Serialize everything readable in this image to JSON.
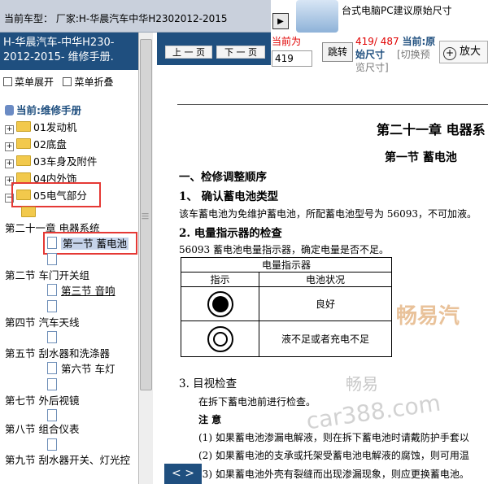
{
  "header": {
    "car_model": "当前车型： 厂家:H-华晨汽车中华H2302012-2015",
    "banner_text": "台式电脑PC建议原始尺寸"
  },
  "sidebar": {
    "doc_title": "H-华晨汽车-中华H230-2012-2015- 维修手册.",
    "expand_all": "菜单展开",
    "collapse_all": "菜单折叠",
    "root_label": "当前:维修手册",
    "folders": [
      "01发动机",
      "02底盘",
      "03车身及附件",
      "04内外饰",
      "05电气部分"
    ],
    "items": [
      {
        "label": "第二十一章 电器系统",
        "type": "chapter"
      },
      {
        "label": "第一节 蓄电池",
        "type": "page",
        "selected": true
      },
      {
        "label": "",
        "type": "page"
      },
      {
        "label": "第二节 车门开关组",
        "type": "chapter"
      },
      {
        "label": "第三节 音响",
        "type": "page"
      },
      {
        "label": "",
        "type": "page"
      },
      {
        "label": "第四节 汽车天线",
        "type": "chapter"
      },
      {
        "label": "",
        "type": "page"
      },
      {
        "label": "第五节 刮水器和洗涤器",
        "type": "chapter"
      },
      {
        "label": "第六节 车灯",
        "type": "page"
      },
      {
        "label": "",
        "type": "page"
      },
      {
        "label": "第七节 外后视镜",
        "type": "chapter"
      },
      {
        "label": "",
        "type": "page"
      },
      {
        "label": "第八节 组合仪表",
        "type": "chapter"
      },
      {
        "label": "",
        "type": "page"
      },
      {
        "label": "第九节 刮水器开关、灯光控",
        "type": "chapter"
      }
    ]
  },
  "toolbar": {
    "prev_page": "上 一 页",
    "next_page": "下 一 页",
    "page_label": "当前为",
    "page_value": "419",
    "jump": "跳转",
    "page_count": "419/ 487",
    "current_label": "当前:原",
    "mode_label": "始尺寸",
    "switch_label": "[切换预",
    "switch_label2": "览尺寸]",
    "zoom": "放大"
  },
  "document": {
    "chapter_title": "第二十一章  电器系",
    "section_title": "第一节  蓄电池",
    "h1": "一、检修调整顺序",
    "h2_1": "1、 确认蓄电池类型",
    "p1": "该车蓄电池为免维护蓄电池，所配蓄电池型号为 56093，不可加液。",
    "h2_2": "2.  电量指示器的检查",
    "p2": "56093 蓄电池电量指示器，确定电量是否不足。",
    "table": {
      "caption": "电量指示器",
      "col_indicator": "指示",
      "col_status": "电池状况",
      "row1_status": "良好",
      "row2_status": "液不足或者充电不足"
    },
    "h2_3": "3.  目视检查",
    "p3": "在拆下蓄电池前进行检查。",
    "note_title": "注  意",
    "note1": "(1)  如果蓄电池渗漏电解液，则在拆下蓄电池时请戴防护手套以",
    "note2": "(2)  如果蓄电池的支承或托架受蓄电池电解液的腐蚀，则可用温",
    "note3": "(3)  如果蓄电池外壳有裂缝而出现渗漏现象，则应更换蓄电池。"
  },
  "watermarks": {
    "w1": "畅易汽",
    "w2": "畅易",
    "w3": "car388.com"
  },
  "pager": {
    "label": "< >"
  }
}
